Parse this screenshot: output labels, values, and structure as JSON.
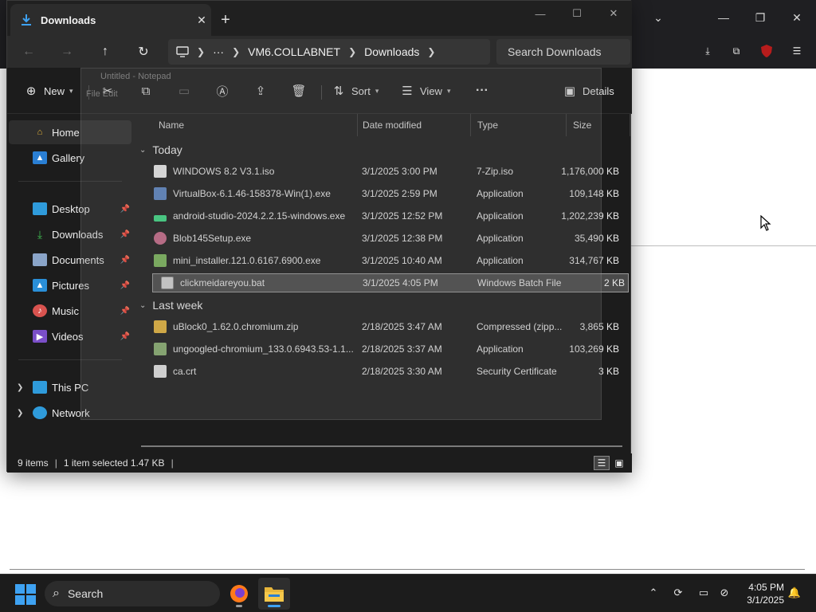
{
  "explorer": {
    "tab_title": "Downloads",
    "breadcrumbs": [
      "VM6.COLLABNET",
      "Downloads"
    ],
    "breadcrumb_more": "···",
    "search_placeholder": "Search Downloads",
    "commands": {
      "new_label": "New",
      "sort_label": "Sort",
      "view_label": "View",
      "more_label": "···",
      "details_label": "Details"
    },
    "sidebar": {
      "items": [
        {
          "label": "Home",
          "icon": "home-icon"
        },
        {
          "label": "Gallery",
          "icon": "gallery-icon"
        },
        {
          "label": "Desktop",
          "icon": "desktop-icon"
        },
        {
          "label": "Downloads",
          "icon": "downloads-icon"
        },
        {
          "label": "Documents",
          "icon": "documents-icon"
        },
        {
          "label": "Pictures",
          "icon": "pictures-icon"
        },
        {
          "label": "Music",
          "icon": "music-icon"
        },
        {
          "label": "Videos",
          "icon": "videos-icon"
        },
        {
          "label": "This PC",
          "icon": "pc-icon"
        },
        {
          "label": "Network",
          "icon": "network-icon"
        }
      ]
    },
    "columns": [
      "Name",
      "Date modified",
      "Type",
      "Size"
    ],
    "groups": [
      {
        "label": "Today",
        "files": [
          {
            "name": "WINDOWS 8.2 V3.1.iso",
            "date": "3/1/2025 3:00 PM",
            "type": "7-Zip.iso",
            "size": "1,176,000 KB"
          },
          {
            "name": "VirtualBox-6.1.46-158378-Win(1).exe",
            "date": "3/1/2025 2:59 PM",
            "type": "Application",
            "size": "109,148 KB"
          },
          {
            "name": "android-studio-2024.2.2.15-windows.exe",
            "date": "3/1/2025 12:52 PM",
            "type": "Application",
            "size": "1,202,239 KB"
          },
          {
            "name": "Blob145Setup.exe",
            "date": "3/1/2025 12:38 PM",
            "type": "Application",
            "size": "35,490 KB"
          },
          {
            "name": "mini_installer.121.0.6167.6900.exe",
            "date": "3/1/2025 10:40 AM",
            "type": "Application",
            "size": "314,767 KB"
          },
          {
            "name": "clickmeidareyou.bat",
            "date": "3/1/2025 4:05 PM",
            "type": "Windows Batch File",
            "size": "2 KB"
          }
        ]
      },
      {
        "label": "Last week",
        "files": [
          {
            "name": "uBlock0_1.62.0.chromium.zip",
            "date": "2/18/2025 3:47 AM",
            "type": "Compressed (zipp...",
            "size": "3,865 KB"
          },
          {
            "name": "ungoogled-chromium_133.0.6943.53-1.1...",
            "date": "2/18/2025 3:37 AM",
            "type": "Application",
            "size": "103,269 KB"
          },
          {
            "name": "ca.crt",
            "date": "2/18/2025 3:30 AM",
            "type": "Security Certificate",
            "size": "3 KB"
          }
        ]
      }
    ],
    "status": {
      "item_count": "9 items",
      "selection": "1 item selected  1.47 KB"
    }
  },
  "notepad_ghost": {
    "title": "Untitled - Notepad",
    "menu": "File  Edit"
  },
  "taskbar": {
    "search_label": "Search",
    "time": "4:05 PM",
    "date": "3/1/2025"
  },
  "colors": {
    "accent": "#3ea2f2",
    "explorer_bg": "#1c1c1c",
    "selection": "#4a4a4a",
    "folder": "#e8b63a"
  }
}
